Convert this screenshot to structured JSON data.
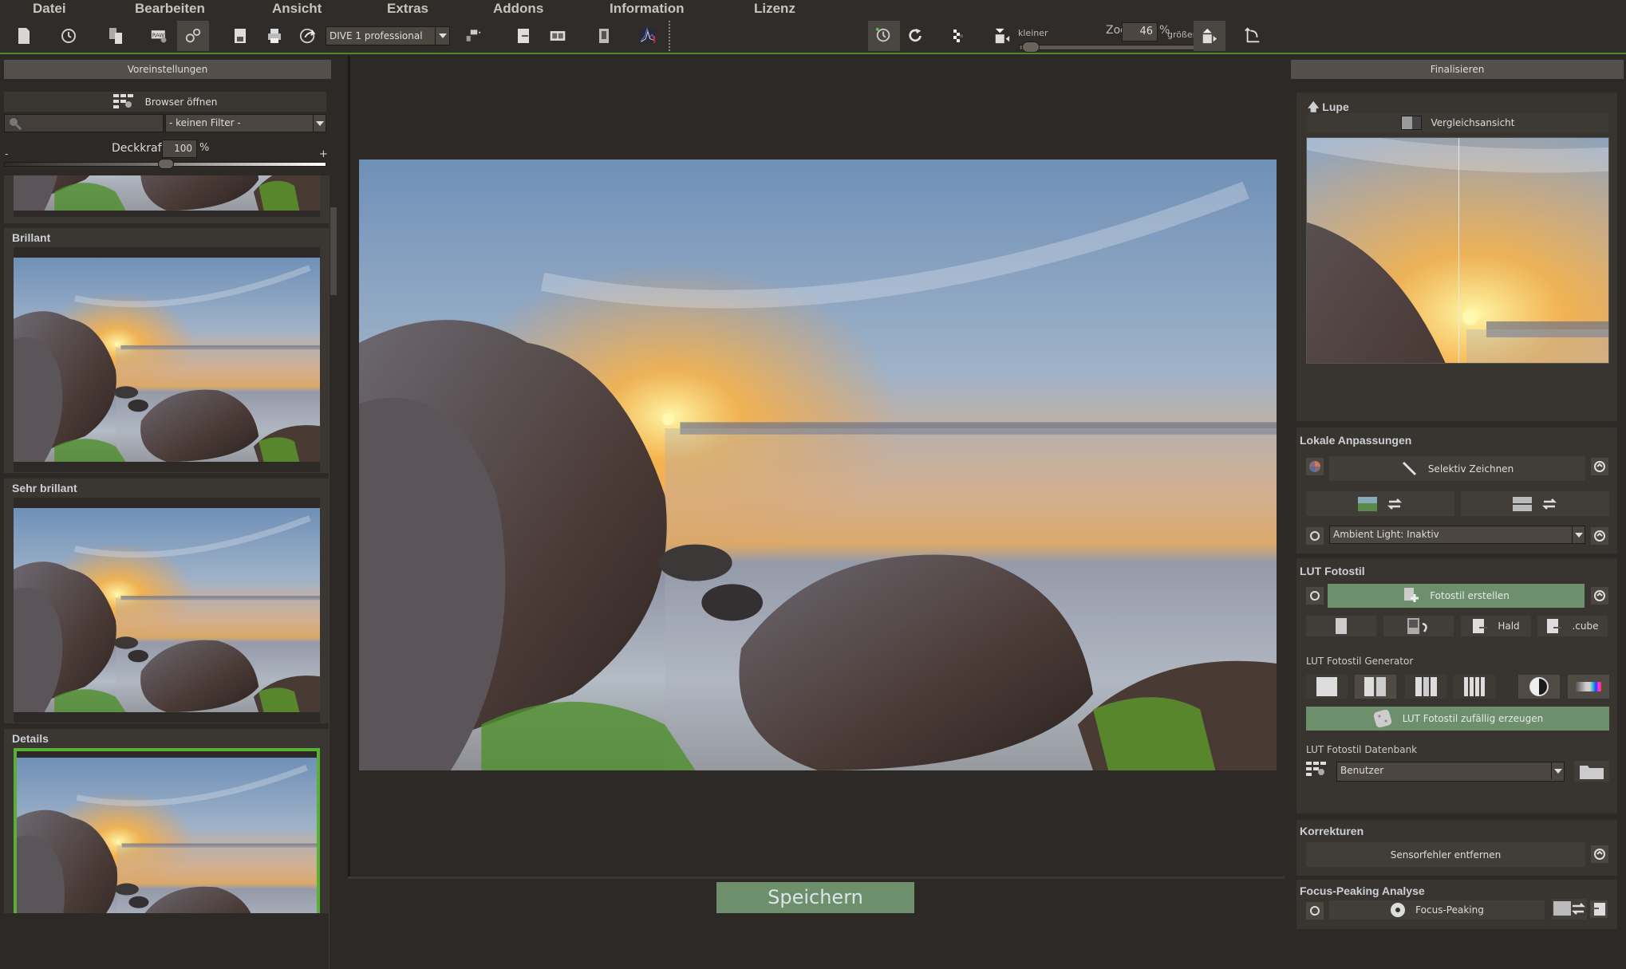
{
  "menu": [
    "Datei",
    "Bearbeiten",
    "Ansicht",
    "Extras",
    "Addons",
    "Information",
    "Lizenz"
  ],
  "toolbar": {
    "icons": [
      "new-file-icon",
      "history-icon",
      "copy-settings-icon",
      "raw-settings-icon",
      "presets-gear-icon",
      "save-icon",
      "print-icon",
      "share-icon",
      "output-device-icon",
      "export-icon",
      "compare-icon",
      "info-panel-icon",
      "histogram-icon",
      "clock-reset-icon",
      "redo-icon",
      "pattern-icon",
      "zoom-out-icon",
      "zoom-in-icon",
      "crop-rotate-icon"
    ],
    "preset_value": "DIVE 1 professional",
    "zoom_smaller_label": "kleiner",
    "zoom_label": "Zoo",
    "zoom_value": "46",
    "zoom_unit": "%",
    "zoom_larger_label": "größer",
    "zoom_slider_fraction": 0.05
  },
  "left_panel": {
    "header": "Voreinstellungen",
    "browser_button": "Browser öffnen",
    "search_placeholder": "",
    "filter_value": "- keinen Filter -",
    "opacity_label": "Deckkraft",
    "opacity_value": "100",
    "opacity_unit": "%",
    "opacity_minus": "-",
    "opacity_plus": "+",
    "presets": [
      {
        "title": "Brillant",
        "selected": false
      },
      {
        "title": "Sehr brillant",
        "selected": false
      },
      {
        "title": "Details",
        "selected": true
      }
    ]
  },
  "main": {
    "save_button": "Speichern"
  },
  "right_panel": {
    "header": "Finalisieren",
    "loupe": {
      "title": "Lupe",
      "compare_label": "Vergleichsansicht"
    },
    "local": {
      "title": "Lokale Anpassungen",
      "selective_draw": "Selektiv Zeichnen",
      "ambient_light_value": "Ambient Light: Inaktiv"
    },
    "lut": {
      "title": "LUT Fotostil",
      "create_button": "Fotostil erstellen",
      "hald_label": "Hald",
      "cube_label": ".cube",
      "generator_title": "LUT Fotostil Generator",
      "random_button": "LUT Fotostil zufällig erzeugen",
      "database_title": "LUT Fotostil Datenbank",
      "database_value": "Benutzer"
    },
    "corrections": {
      "title": "Korrekturen",
      "sensor_button": "Sensorfehler entfernen"
    },
    "focus": {
      "title": "Focus-Peaking Analyse",
      "button": "Focus-Peaking"
    }
  },
  "colors": {
    "accent_green": "#57b233",
    "button_green": "#6e8f6b"
  }
}
